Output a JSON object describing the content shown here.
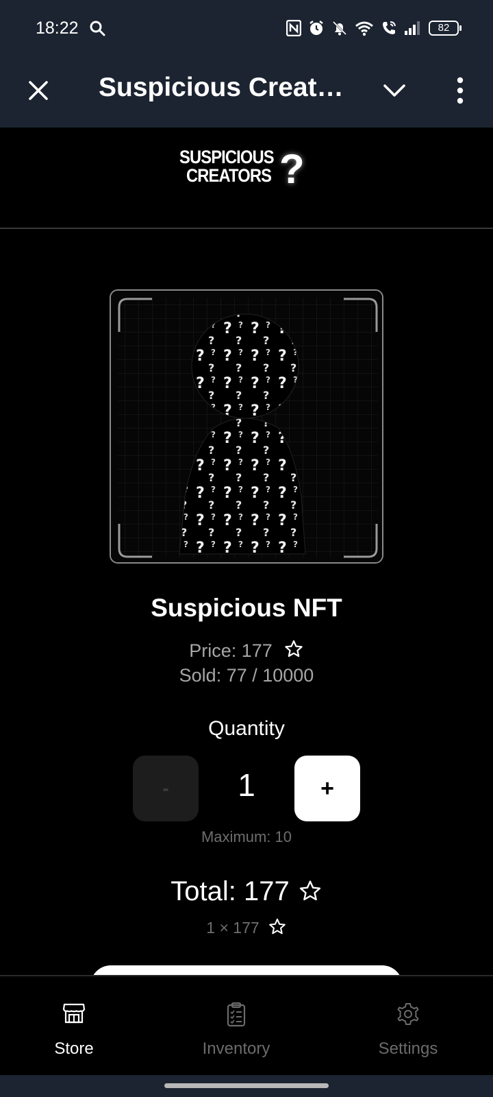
{
  "status_bar": {
    "time": "18:22",
    "battery": "82",
    "icons": [
      "search-icon",
      "nfc-icon",
      "alarm-icon",
      "bell-off-icon",
      "wifi-icon",
      "wifi-call-icon",
      "signal-icon",
      "battery-icon"
    ]
  },
  "app_bar": {
    "title": "Suspicious Creators",
    "icons": [
      "close-icon",
      "chevron-down-icon",
      "more-vertical-icon"
    ]
  },
  "logo": {
    "line1": "SUSPICIOUS",
    "line2": "CREATORS",
    "mark": "?"
  },
  "product": {
    "name": "Suspicious NFT",
    "price_text": "Price: 177",
    "sold_text": "Sold: 77 / 10000",
    "currency_icon": "star-icon"
  },
  "quantity": {
    "label": "Quantity",
    "minus_label": "-",
    "value": "1",
    "plus_label": "+",
    "max_text": "Maximum: 10"
  },
  "total": {
    "text": "Total: 177",
    "calc_text": "1 × 177"
  },
  "bottom_nav": {
    "items": [
      {
        "label": "Store",
        "icon": "store-icon",
        "active": true
      },
      {
        "label": "Inventory",
        "icon": "clipboard-list-icon",
        "active": false
      },
      {
        "label": "Settings",
        "icon": "gear-icon",
        "active": false
      }
    ]
  },
  "colors": {
    "bar_background": "#1c2431",
    "page_background": "#000000",
    "muted_text": "#a6a6a6",
    "dim_text": "#6e6e6e"
  }
}
